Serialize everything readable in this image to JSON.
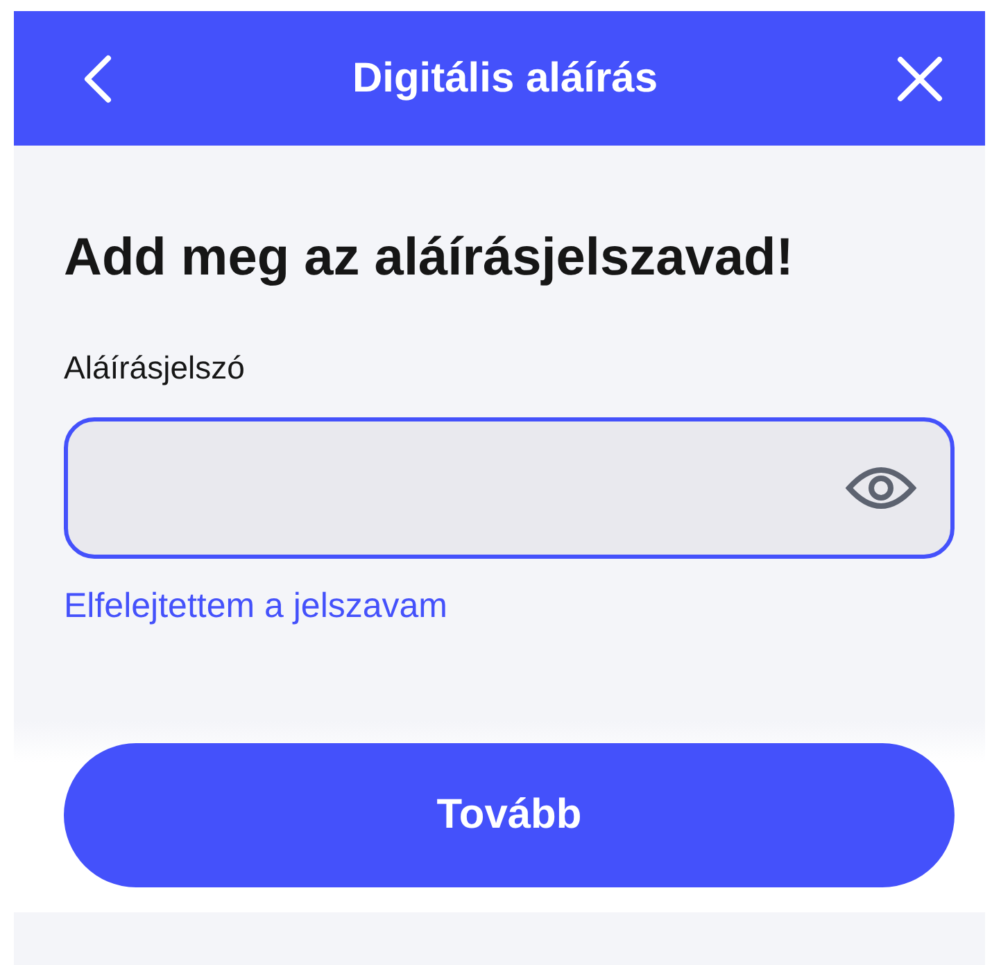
{
  "header": {
    "title": "Digitális aláírás"
  },
  "heading": "Add meg az aláírásjelszavad!",
  "password_field": {
    "label": "Aláírásjelszó",
    "focused": true
  },
  "forgot_link": "Elfelejtettem a jelszavam",
  "continue_button": "Tovább"
}
